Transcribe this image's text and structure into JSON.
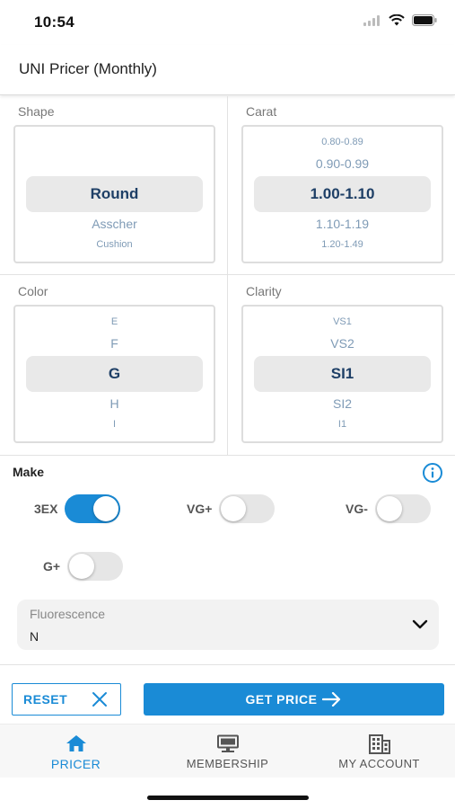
{
  "status": {
    "time": "10:54"
  },
  "header": {
    "title": "UNI Pricer (Monthly)"
  },
  "pickers": {
    "shape": {
      "label": "Shape",
      "above": [],
      "selected": "Round",
      "below": [
        "Asscher",
        "Cushion"
      ]
    },
    "carat": {
      "label": "Carat",
      "above": [
        "0.80-0.89",
        "0.90-0.99"
      ],
      "selected": "1.00-1.10",
      "below": [
        "1.10-1.19",
        "1.20-1.49"
      ]
    },
    "color": {
      "label": "Color",
      "above": [
        "E",
        "F"
      ],
      "selected": "G",
      "below": [
        "H",
        "I"
      ]
    },
    "clarity": {
      "label": "Clarity",
      "above": [
        "VS1",
        "VS2"
      ],
      "selected": "SI1",
      "below": [
        "SI2",
        "I1"
      ]
    }
  },
  "make": {
    "label": "Make",
    "toggles": [
      {
        "label": "3EX",
        "on": true
      },
      {
        "label": "VG+",
        "on": false
      },
      {
        "label": "VG-",
        "on": false
      },
      {
        "label": "G+",
        "on": false
      }
    ]
  },
  "fluorescence": {
    "label": "Fluorescence",
    "value": "N"
  },
  "actions": {
    "reset": "RESET",
    "get_price": "GET PRICE"
  },
  "tabs": [
    {
      "label": "PRICER",
      "icon": "home-icon",
      "active": true
    },
    {
      "label": "MEMBERSHIP",
      "icon": "monitor-icon",
      "active": false
    },
    {
      "label": "MY ACCOUNT",
      "icon": "building-icon",
      "active": false
    }
  ],
  "colors": {
    "accent": "#1a8bd6",
    "selected_text": "#1e3f66",
    "muted_text": "#7f9bb6"
  }
}
